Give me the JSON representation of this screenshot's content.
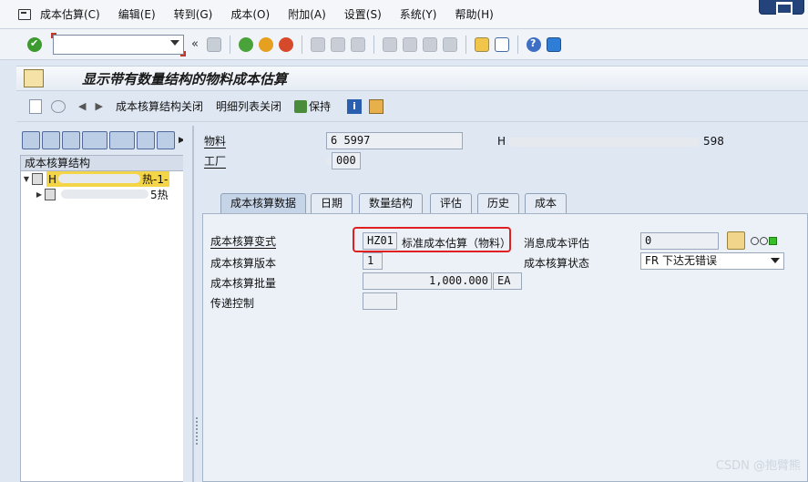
{
  "menu": {
    "items": [
      "成本估算(C)",
      "编辑(E)",
      "转到(G)",
      "成本(O)",
      "附加(A)",
      "设置(S)",
      "系统(Y)",
      "帮助(H)"
    ]
  },
  "toolbar": {
    "command_value": "",
    "command_placeholder": "",
    "chevron": "«"
  },
  "title": {
    "text": "显示带有数量结构的物料成本估算"
  },
  "app_toolbar": {
    "costing_structure_off": "成本核算结构关闭",
    "itemization_off": "明细列表关闭",
    "keep": "保持"
  },
  "tree": {
    "header": "成本核算结构",
    "rows": [
      {
        "text_start": "H",
        "text_end": "热-1-"
      },
      {
        "text_start": "",
        "text_end": "5热"
      }
    ]
  },
  "header_fields": {
    "material_label": "物料",
    "material_value": "6  5997",
    "material_desc_end": "598",
    "material_desc_start": "H",
    "plant_label": "工厂",
    "plant_value": "000"
  },
  "tabs": [
    "成本核算数据",
    "日期",
    "数量结构",
    "评估",
    "历史",
    "成本"
  ],
  "costing_data": {
    "variant_label": "成本核算变式",
    "variant_code": "HZ01",
    "variant_desc": "标准成本估算（物料）",
    "version_label": "成本核算版本",
    "version_value": "1",
    "lot_label": "成本核算批量",
    "lot_value": "1,000.000",
    "lot_unit": "EA",
    "transfer_label": "传递控制",
    "transfer_value": "",
    "cancel_label": "消息成本评估",
    "cancel_value": "0",
    "status_label": "成本核算状态",
    "status_value": "FR 下达无错误"
  },
  "watermark": "CSDN @抱臂熊",
  "colors": {
    "status_green": "#35c125",
    "highlight_red": "#e02020",
    "tree_highlight": "#f5d548"
  }
}
